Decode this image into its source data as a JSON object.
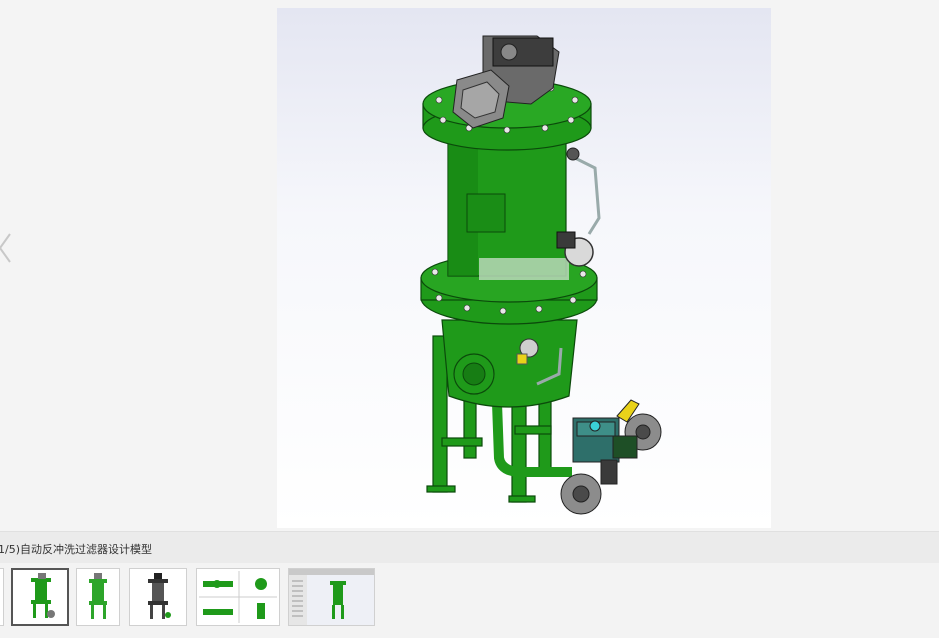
{
  "gallery": {
    "caption": "1/5)自动反冲洗过滤器设计模型",
    "prev_icon": "chevron-left-icon",
    "active_index": 0,
    "thumbnails": [
      {
        "name": "thumbnail-front-view",
        "icon": "filter-model-icon"
      },
      {
        "name": "thumbnail-green-model",
        "icon": "filter-model-icon"
      },
      {
        "name": "thumbnail-wireframe-model",
        "icon": "filter-model-icon"
      },
      {
        "name": "thumbnail-drawing-views",
        "icon": "drawing-icon"
      },
      {
        "name": "thumbnail-cad-screenshot",
        "icon": "cad-window-icon"
      }
    ]
  },
  "colors": {
    "body_green": "#1f9a1a",
    "dark_green": "#0f6a10",
    "motor_gray": "#6a6a6a",
    "valve_teal": "#2e6f6a",
    "handle_yellow": "#e9d219"
  }
}
